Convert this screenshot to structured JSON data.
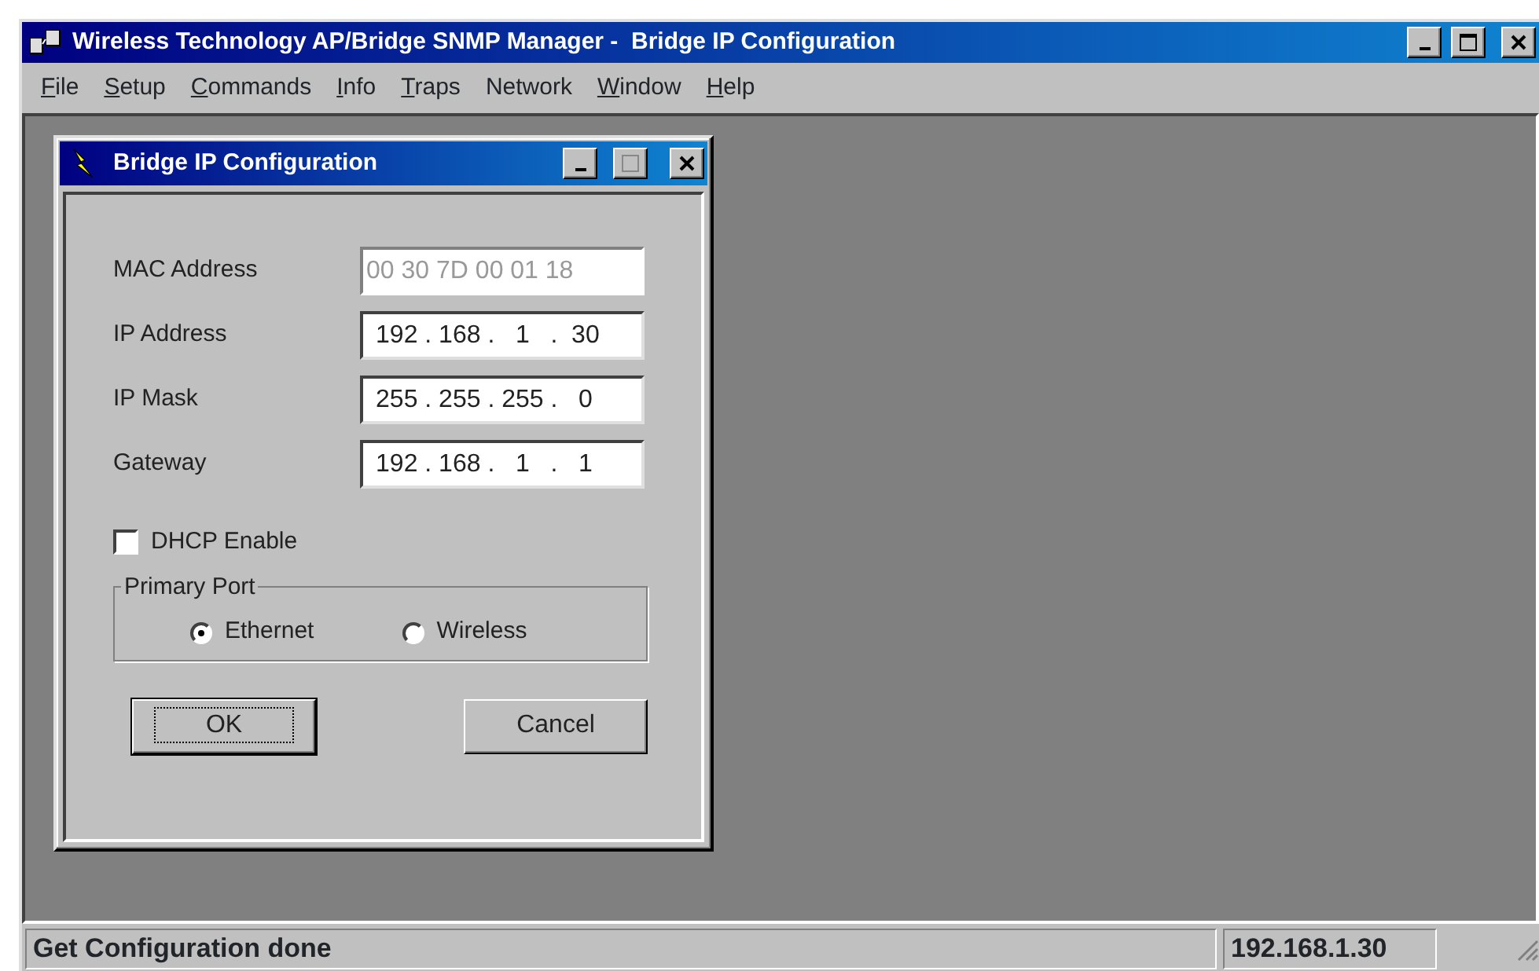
{
  "window": {
    "title": "Wireless Technology AP/Bridge SNMP Manager -  Bridge IP Configuration"
  },
  "menu": [
    {
      "access_key": "F",
      "rest": "ile"
    },
    {
      "access_key": "S",
      "rest": "etup"
    },
    {
      "access_key": "C",
      "rest": "ommands"
    },
    {
      "access_key": "I",
      "rest": "nfo"
    },
    {
      "access_key": "T",
      "rest": "raps"
    },
    {
      "rest": "Network"
    },
    {
      "access_key": "W",
      "rest": "indow"
    },
    {
      "access_key": "H",
      "rest": "elp"
    }
  ],
  "dialog": {
    "title": "Bridge IP Configuration",
    "fields": [
      {
        "label": "MAC Address",
        "value": "00 30 7D 00 01 18",
        "disabled": true
      },
      {
        "label": "IP Address",
        "value": "192 . 168 .   1   .  30",
        "disabled": false
      },
      {
        "label": "IP Mask",
        "value": "255 . 255 . 255 .   0",
        "disabled": false
      },
      {
        "label": "Gateway",
        "value": "192 . 168 .   1   .   1",
        "disabled": false
      }
    ],
    "dhcp": {
      "label": "DHCP Enable",
      "checked": false
    },
    "primary_port": {
      "title": "Primary Port",
      "options": [
        {
          "label": "Ethernet",
          "selected": true
        },
        {
          "label": "Wireless",
          "selected": false
        }
      ]
    },
    "buttons": [
      {
        "label": "OK",
        "default": true
      },
      {
        "label": "Cancel",
        "default": false
      }
    ]
  },
  "status_bar": {
    "message": "Get Configuration done",
    "address": "192.168.1.30"
  }
}
